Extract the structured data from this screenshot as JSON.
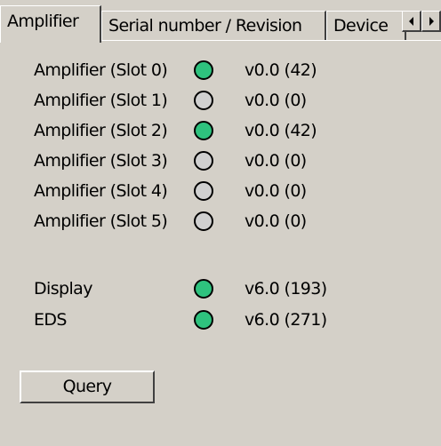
{
  "tabs": [
    {
      "label": "Amplifier",
      "active": true
    },
    {
      "label": "Serial number / Revision",
      "active": false
    },
    {
      "label": "Device",
      "active": false
    }
  ],
  "tab_scroll": {
    "left_icon": "triangle-left-icon",
    "right_icon": "triangle-right-icon"
  },
  "status_rows": [
    {
      "label": "Amplifier (Slot 0)",
      "status": "active",
      "version": "v0.0 (42)"
    },
    {
      "label": "Amplifier (Slot 1)",
      "status": "inactive",
      "version": "v0.0 (0)"
    },
    {
      "label": "Amplifier (Slot 2)",
      "status": "active",
      "version": "v0.0 (42)"
    },
    {
      "label": "Amplifier (Slot 3)",
      "status": "inactive",
      "version": "v0.0 (0)"
    },
    {
      "label": "Amplifier (Slot 4)",
      "status": "inactive",
      "version": "v0.0 (0)"
    },
    {
      "label": "Amplifier (Slot 5)",
      "status": "inactive",
      "version": "v0.0 (0)"
    },
    {
      "label": "Display",
      "status": "active",
      "version": "v6.0 (193)"
    },
    {
      "label": "EDS",
      "status": "active",
      "version": "v6.0 (271)"
    }
  ],
  "colors": {
    "led_active": "#2ec27e",
    "led_inactive": "#d0d0d0",
    "panel_background": "#d4d0c8"
  },
  "query_button": {
    "label": "Query"
  }
}
